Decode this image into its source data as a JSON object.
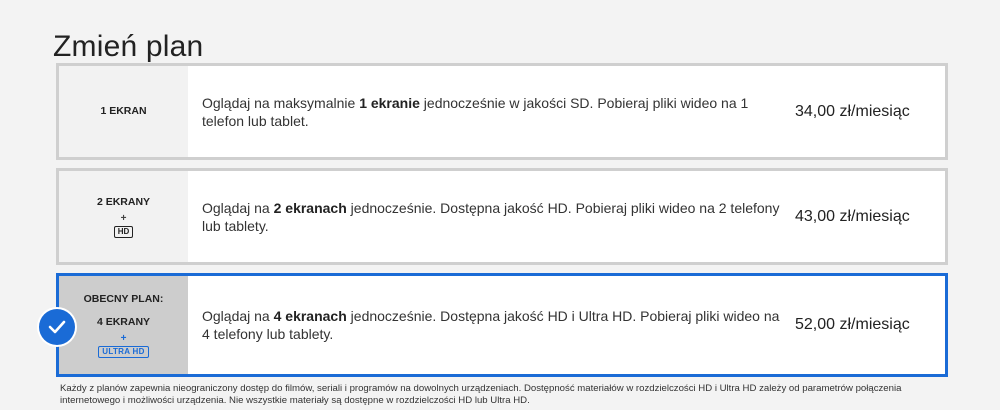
{
  "page_title": "Zmień plan",
  "plans": [
    {
      "screens": "1 EKRAN",
      "desc_pre": "Oglądaj na maksymalnie ",
      "desc_bold": "1 ekranie",
      "desc_post": " jednocześnie w jakości SD. Pobieraj pliki wideo na 1 telefon lub tablet.",
      "price": "34,00 zł/miesiąc"
    },
    {
      "screens": "2 EKRANY",
      "plus": "+",
      "badge": "HD",
      "desc_pre": "Oglądaj na ",
      "desc_bold": "2 ekranach",
      "desc_post": " jednocześnie. Dostępna jakość HD. Pobieraj pliki wideo na 2 telefony lub tablety.",
      "price": "43,00 zł/miesiąc"
    },
    {
      "current_label": "OBECNY PLAN:",
      "screens": "4 EKRANY",
      "plus": "+",
      "badge": "ULTRA HD",
      "desc_pre": "Oglądaj na ",
      "desc_bold": "4 ekranach",
      "desc_post": " jednocześnie. Dostępna jakość HD i Ultra HD. Pobieraj pliki wideo na 4 telefony lub tablety.",
      "price": "52,00 zł/miesiąc"
    }
  ],
  "footnote": "Każdy z planów zapewnia nieograniczony dostęp do filmów, seriali i programów na dowolnych urządzeniach. Dostępność materiałów w rozdzielczości HD i Ultra HD zależy od parametrów połączenia internetowego i możliwości urządzenia. Nie wszystkie materiały są dostępne w rozdzielczości HD lub Ultra HD.",
  "colors": {
    "selected_border": "#1a6bd6",
    "default_border": "#cfcfcf"
  }
}
